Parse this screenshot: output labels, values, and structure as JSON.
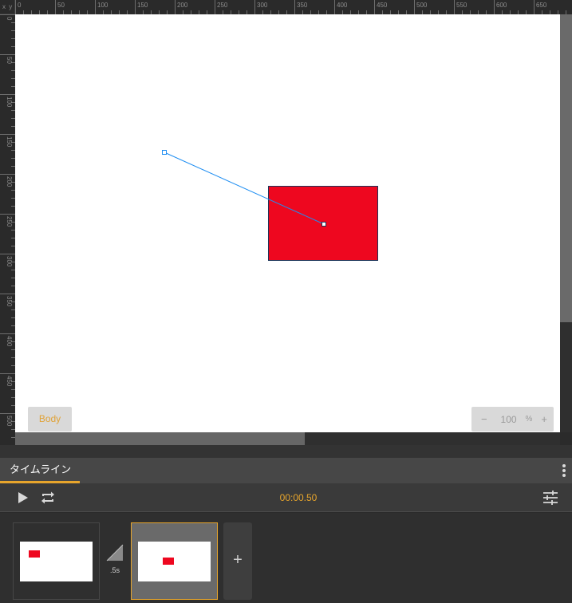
{
  "ruler": {
    "corner_label": "x y",
    "top_ticks": [
      "0",
      "50",
      "100",
      "150",
      "200",
      "250",
      "300",
      "350",
      "400",
      "450",
      "500",
      "550",
      "600",
      "650"
    ],
    "left_ticks": [
      "0",
      "50",
      "100",
      "150",
      "200",
      "250",
      "300",
      "350",
      "400",
      "450",
      "500"
    ]
  },
  "canvas": {
    "background": "#ffffff",
    "shape_color": "#ee071f",
    "motion_path_color": "#1f8ef2"
  },
  "overlay": {
    "body_button": "Body",
    "zoom_minus": "−",
    "zoom_value": "100",
    "zoom_unit": "%",
    "zoom_plus": "+"
  },
  "timeline": {
    "tab_label": "タイムライン",
    "menu_icon": "more-vertical-icon",
    "play_icon": "play-icon",
    "loop_icon": "loop-icon",
    "current_time": "00:00.50",
    "settings_icon": "sliders-icon",
    "transition_label": ".5s",
    "add_label": "+",
    "accent_color": "#e7a52c"
  }
}
